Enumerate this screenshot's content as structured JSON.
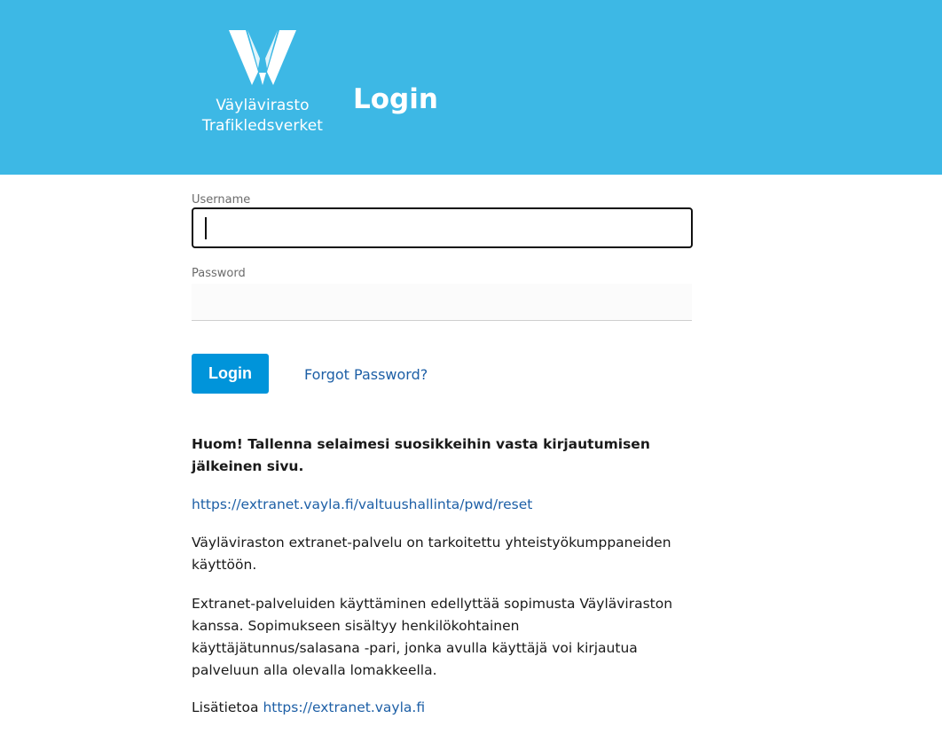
{
  "header": {
    "logo_line1": "Väylävirasto",
    "logo_line2": "Trafikledsverket",
    "title": "Login",
    "background_color": "#3db8e5"
  },
  "form": {
    "username_label": "Username",
    "username_value": "",
    "password_label": "Password",
    "password_value": "",
    "login_button_label": "Login",
    "forgot_password_label": "Forgot Password?",
    "button_color": "#0094da"
  },
  "info": {
    "notice": "Huom! Tallenna selaimesi suosikkeihin vasta kirjautumisen jälkeinen sivu.",
    "reset_link": "https://extranet.vayla.fi/valtuushallinta/pwd/reset",
    "description_1": "Väyläviraston extranet-palvelu on tarkoitettu yhteistyökumppaneiden käyttöön.",
    "description_2": "Extranet-palveluiden käyttäminen edellyttää sopimusta Väyläviraston kanssa. Sopimukseen sisältyy henkilökohtainen käyttäjätunnus/salasana -pari, jonka avulla käyttäjä voi kirjautua palveluun alla olevalla lomakkeella.",
    "more_info_prefix": "Lisätietoa",
    "more_info_link": "https://extranet.vayla.fi",
    "link_color": "#1d5fa6"
  }
}
